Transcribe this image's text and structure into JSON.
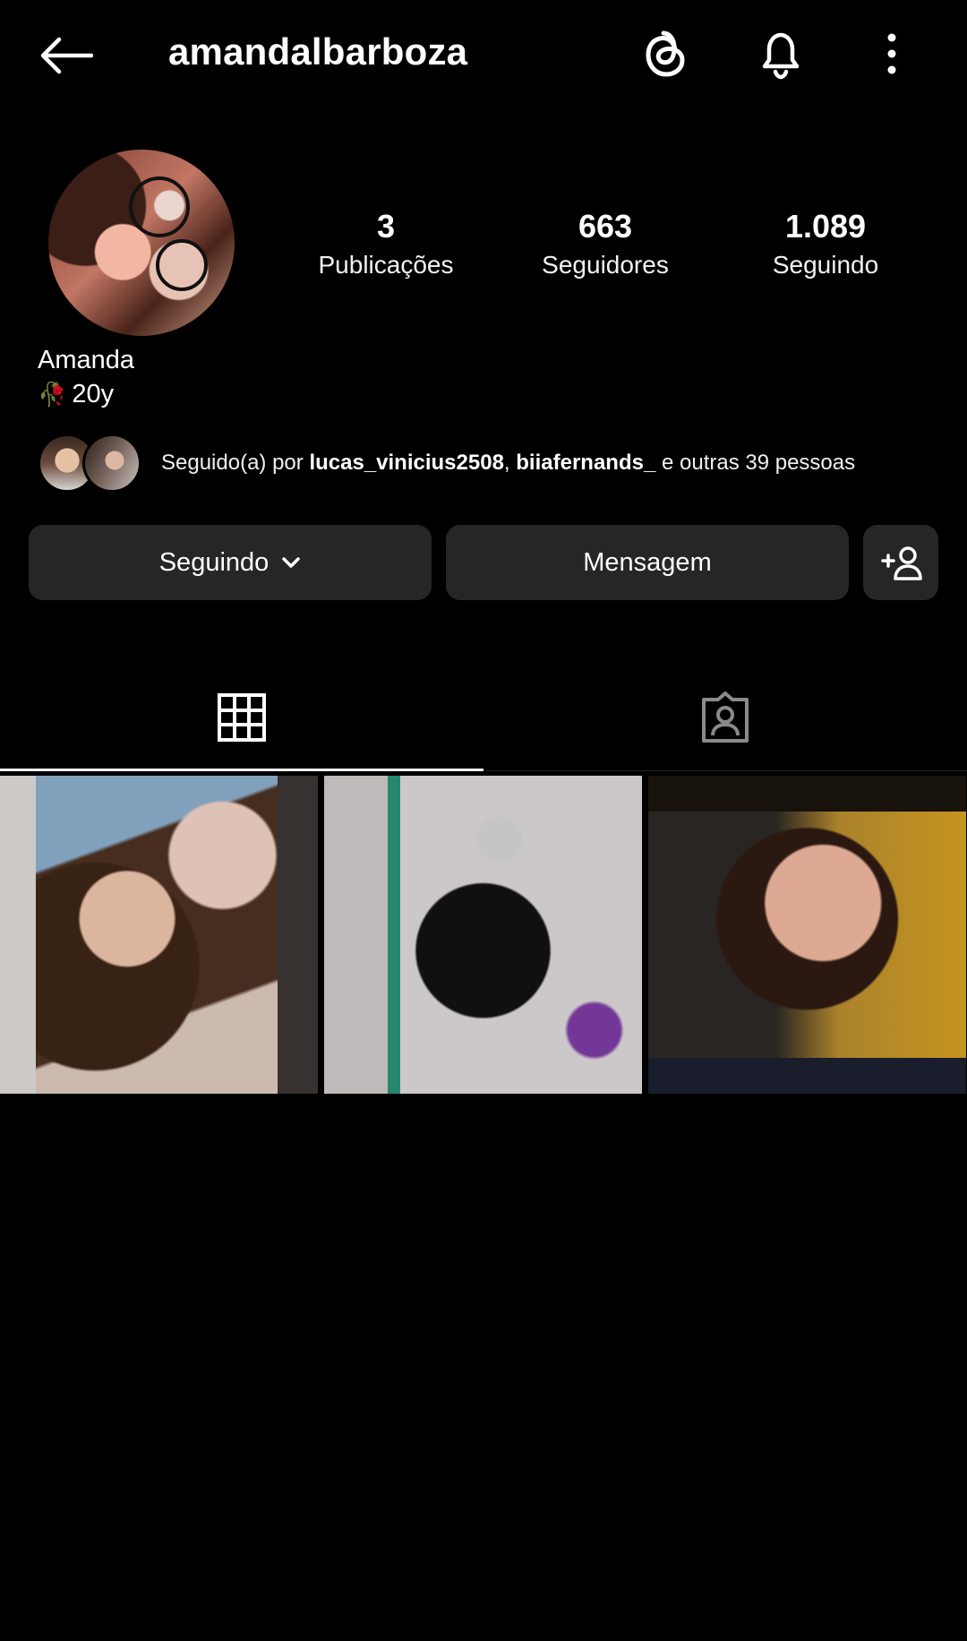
{
  "header": {
    "username": "amandalbarboza"
  },
  "profile": {
    "stats": [
      {
        "value": "3",
        "label": "Publicações"
      },
      {
        "value": "663",
        "label": "Seguidores"
      },
      {
        "value": "1.089",
        "label": "Seguindo"
      }
    ],
    "full_name": "Amanda",
    "bio": "20y",
    "followed_by": {
      "prefix": "Seguido(a) por ",
      "user1": "lucas_vinicius2508",
      "separator": ", ",
      "user2": "biiafernands_",
      "suffix": " e outras 39 pessoas"
    }
  },
  "actions": {
    "following_label": "Seguindo",
    "message_label": "Mensagem"
  },
  "tabs": {
    "active": "posts-grid"
  },
  "colors": {
    "background": "#000000",
    "button_bg": "#262626",
    "text": "#ffffff"
  }
}
